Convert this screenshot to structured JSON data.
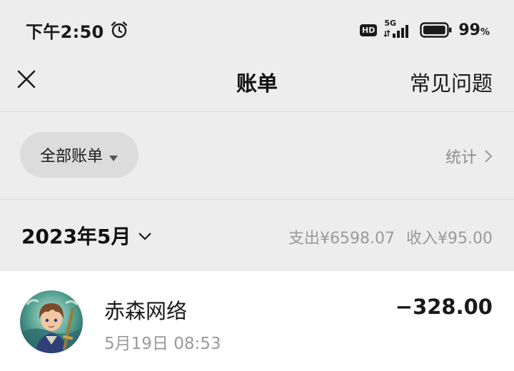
{
  "status_bar": {
    "time": "下午2:50",
    "network": "5G",
    "hd": "HD",
    "battery_value": "99",
    "battery_unit": "%",
    "battery_level": 0.99
  },
  "header": {
    "title": "账单",
    "faq_label": "常见问题"
  },
  "filter": {
    "label": "全部账单",
    "stats_label": "统计"
  },
  "month": {
    "label": "2023年5月",
    "expense": "支出¥6598.07",
    "income": "收入¥95.00"
  },
  "transactions": [
    {
      "name": "赤森网络",
      "time": "5月19日 08:53",
      "amount": "−328.00"
    }
  ],
  "icons": {
    "close": "close-icon",
    "alarm": "alarm-clock-icon",
    "caret": "caret-down-icon",
    "chevron_right": "chevron-right-icon",
    "chevron_down": "chevron-down-icon"
  }
}
